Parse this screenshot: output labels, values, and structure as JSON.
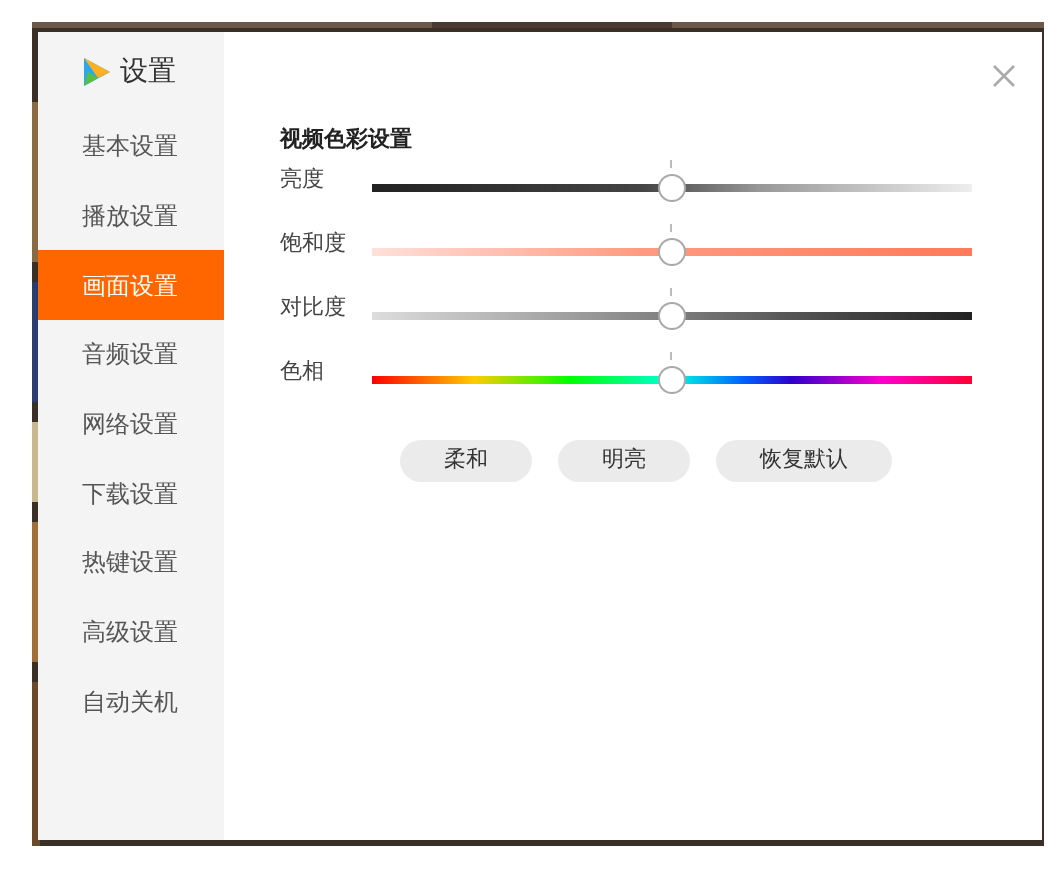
{
  "window": {
    "title": "设置"
  },
  "sidebar": {
    "items": [
      {
        "label": "基本设置",
        "selected": false
      },
      {
        "label": "播放设置",
        "selected": false
      },
      {
        "label": "画面设置",
        "selected": true
      },
      {
        "label": "音频设置",
        "selected": false
      },
      {
        "label": "网络设置",
        "selected": false
      },
      {
        "label": "下载设置",
        "selected": false
      },
      {
        "label": "热键设置",
        "selected": false
      },
      {
        "label": "高级设置",
        "selected": false
      },
      {
        "label": "自动关机",
        "selected": false
      }
    ]
  },
  "section": {
    "title": "视频色彩设置",
    "sliders": [
      {
        "label": "亮度",
        "level": 0.5
      },
      {
        "label": "饱和度",
        "level": 0.5
      },
      {
        "label": "对比度",
        "level": 0.5
      },
      {
        "label": "色相",
        "level": 0.5
      }
    ],
    "buttons": [
      "柔和",
      "明亮",
      "恢复默认"
    ]
  }
}
